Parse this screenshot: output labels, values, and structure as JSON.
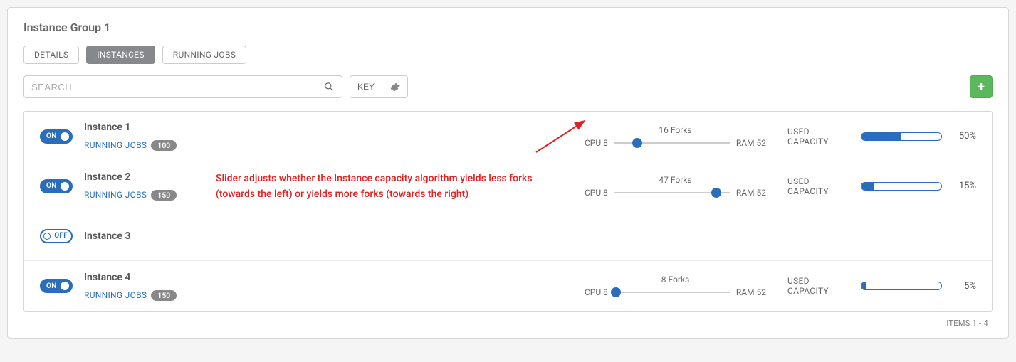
{
  "title": "Instance Group 1",
  "tabs": {
    "details": "DETAILS",
    "instances": "INSTANCES",
    "running_jobs": "RUNNING JOBS"
  },
  "search": {
    "placeholder": "SEARCH",
    "key_label": "KEY"
  },
  "add_icon": "+",
  "toggle": {
    "on": "ON",
    "off": "OFF"
  },
  "labels": {
    "running_jobs": "RUNNING JOBS",
    "used_capacity": "USED CAPACITY",
    "cpu_prefix": "CPU",
    "ram_prefix": "RAM",
    "forks_suffix": "Forks"
  },
  "instances": [
    {
      "name": "Instance 1",
      "on": true,
      "jobs": 100,
      "cpu": 8,
      "ram": 52,
      "forks": 16,
      "slider_pct": 20,
      "capacity_pct": 50
    },
    {
      "name": "Instance 2",
      "on": true,
      "jobs": 150,
      "cpu": 8,
      "ram": 52,
      "forks": 47,
      "slider_pct": 88,
      "capacity_pct": 15
    },
    {
      "name": "Instance 3",
      "on": false
    },
    {
      "name": "Instance 4",
      "on": true,
      "jobs": 150,
      "cpu": 8,
      "ram": 52,
      "forks": 8,
      "slider_pct": 2,
      "capacity_pct": 5
    }
  ],
  "annotation": "Slider adjusts whether the Instance capacity algorithm yields less forks (towards the left) or yields more forks (towards the right)",
  "footer": "ITEMS  1 - 4"
}
